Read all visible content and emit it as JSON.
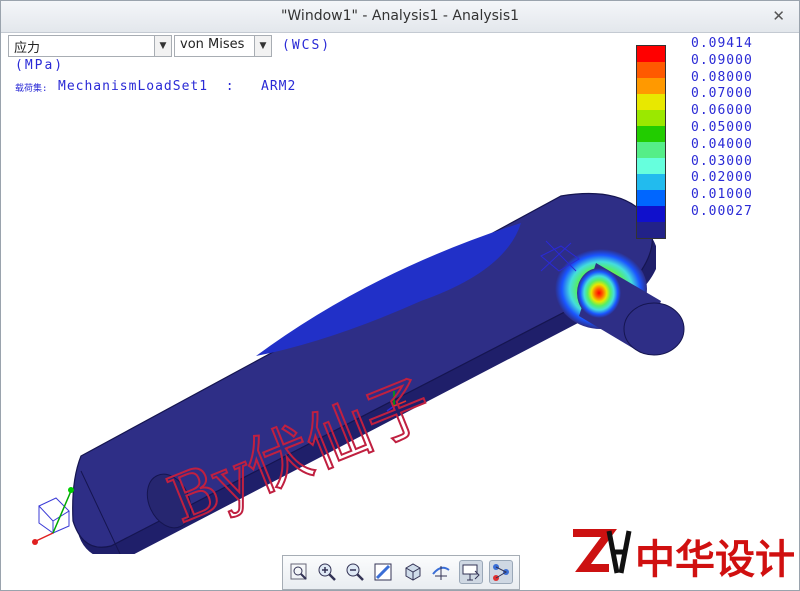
{
  "window": {
    "title": "\"Window1\" - Analysis1 - Analysis1"
  },
  "controls": {
    "result_type": {
      "value": "应力"
    },
    "component": {
      "value": "von Mises"
    },
    "coord_system": "(WCS)"
  },
  "info": {
    "units": "(MPa)",
    "loadset_label": "载荷集:",
    "loadset_value": "MechanismLoadSet1  :   ARM2"
  },
  "legend": {
    "values": [
      "0.09414",
      "0.09000",
      "0.08000",
      "0.07000",
      "0.06000",
      "0.05000",
      "0.04000",
      "0.03000",
      "0.02000",
      "0.01000",
      "0.00027"
    ],
    "colors": [
      "#ff0000",
      "#ff5a00",
      "#ff9900",
      "#e8e800",
      "#9be800",
      "#22cc00",
      "#55ee88",
      "#66ffdd",
      "#22bbee",
      "#0066ff",
      "#1010cc",
      "#222288"
    ]
  },
  "model": {
    "body_color": "#2e2e86",
    "hot_color": "#ff2200"
  },
  "watermark": {
    "text": "By伏仙子"
  },
  "logo": {
    "text": "中华设计",
    "mark": "ZH"
  },
  "toolbar": {
    "buttons": [
      "zoom-fit-icon",
      "zoom-in-icon",
      "zoom-out-icon",
      "repaint-icon",
      "shaded-icon",
      "spin-center-icon",
      "view-manager-icon",
      "display-options-icon"
    ]
  }
}
